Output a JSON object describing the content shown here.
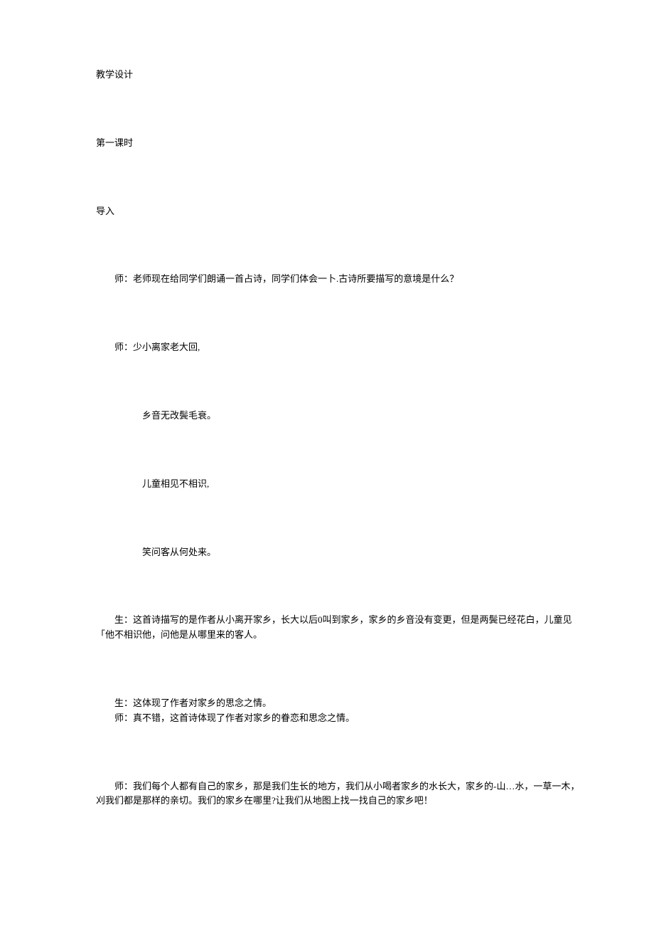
{
  "headings": {
    "title": "教学设计",
    "lesson": "第一课时",
    "intro": "导入"
  },
  "teacher": {
    "opening": "师：老师现在给同学们朗诵一首占诗，同学们体会一卜.古诗所要描写的意境是什么？",
    "poem_start": "师：少小离家老大回,",
    "comment": "师：真不错，这首诗体现了作者对家乡的眷恋和思念之情。",
    "closing": "师：我们每个人都有自己的家乡，那是我们生长的地方，我们从小喝者家乡的水长大，家乡的-山…水，一草一木，刈我们都是那样的亲切。我们的家乡在哪里?让我们从地图上找一找自己的家乡吧！"
  },
  "poem": {
    "line2": "乡音无改鬓毛衰。",
    "line3": "儿童相见不相识,",
    "line4": "笑问客从何处来。"
  },
  "student": {
    "response1": "生：这首诗描写的是作者从小离开家乡，长大以后0叫到家乡，家乡的乡音没有变更，但是两鬓已经花白，儿童见「他不相识他，问他是从哪里来的客人。",
    "response2": "生：这体现了作者对家乡的思念之情。"
  }
}
